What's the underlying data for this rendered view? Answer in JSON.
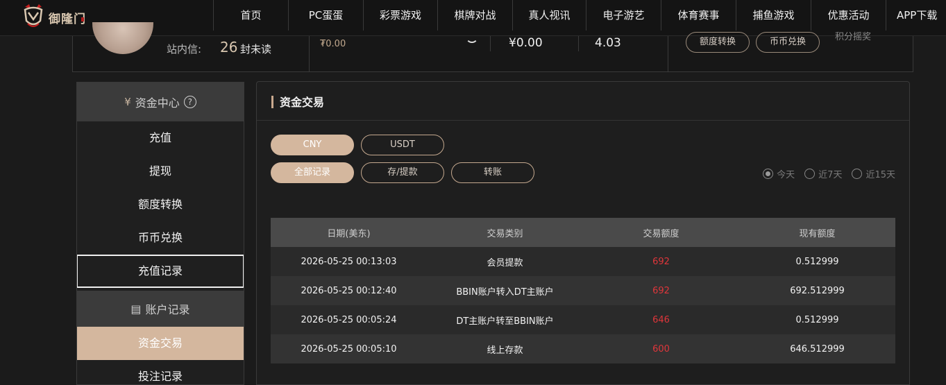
{
  "brand": {
    "name": "御隆门"
  },
  "nav": [
    "首页",
    "PC蛋蛋",
    "彩票游戏",
    "棋牌对战",
    "真人视讯",
    "电子游艺",
    "体育赛事",
    "捕鱼游戏",
    "优惠活动",
    "APP下载"
  ],
  "user_strip": {
    "mail_label": "站内信:",
    "mail_count": "26",
    "mail_unread": "封未读",
    "small_balance": "₮0.00",
    "balance_cny": "¥0.00",
    "balance_other": "4.03",
    "btn_transfer": "额度转换",
    "btn_exchange": "币币兑换",
    "tail_text": "积分摇奖"
  },
  "sidebar": {
    "section1": "资金中心",
    "help": "?",
    "items": [
      "充值",
      "提现",
      "额度转换",
      "币币兑换",
      "充值记录"
    ],
    "section2": "账户记录",
    "items2": [
      "资金交易",
      "投注记录"
    ]
  },
  "panel": {
    "title": "资金交易",
    "currency_tabs": [
      "CNY",
      "USDT"
    ],
    "type_tabs": [
      "全部记录",
      "存/提款",
      "转账"
    ],
    "periods": [
      "今天",
      "近7天",
      "近15天"
    ],
    "selected_period": "今天"
  },
  "table": {
    "headers": [
      "日期(美东)",
      "交易类别",
      "交易额度",
      "现有额度"
    ],
    "rows": [
      [
        "2026-05-25 00:13:03",
        "会员提款",
        "692",
        "0.512999"
      ],
      [
        "2026-05-25 00:12:40",
        "BBIN账户转入DT主账户",
        "692",
        "692.512999"
      ],
      [
        "2026-05-25 00:05:24",
        "DT主账户转至BBIN账户",
        "646",
        "0.512999"
      ],
      [
        "2026-05-25 00:05:10",
        "线上存款",
        "600",
        "646.512999"
      ]
    ]
  },
  "colors": {
    "accent": "#d4b79e",
    "amount": "#e0363b",
    "background": "#1b1b1b"
  }
}
